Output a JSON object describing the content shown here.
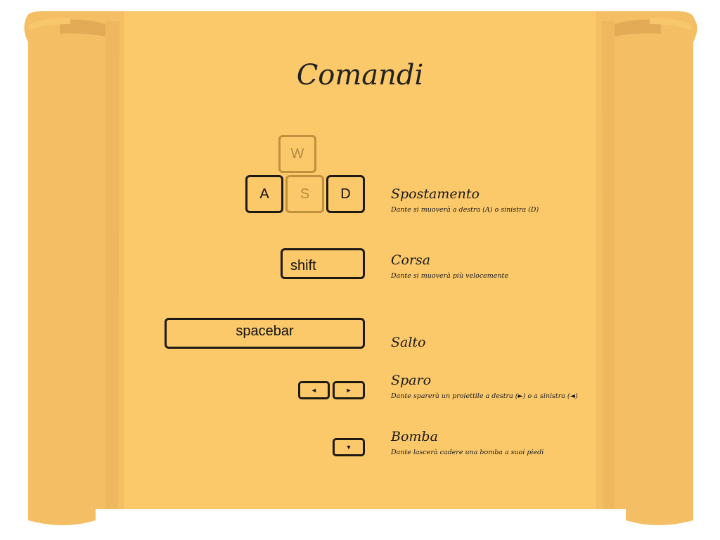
{
  "title": "Comandi",
  "colors": {
    "parchment": "#fbc86a",
    "parchment_shadow": "#f1bd63",
    "roll_inner": "#e7b05b",
    "key_border": "#1e1a12",
    "key_dim": "#c0913c"
  },
  "keys": {
    "w": "W",
    "a": "A",
    "s": "S",
    "d": "D",
    "shift": "shift",
    "spacebar": "spacebar",
    "left_arrow": "◄",
    "right_arrow": "►",
    "down_arrow": "▼"
  },
  "controls": [
    {
      "title": "Spostamento",
      "description": "Dante si muoverà a destra (A) o sinistra (D)"
    },
    {
      "title": "Corsa",
      "description": "Dante si muoverà più velocemente"
    },
    {
      "title": "Salto",
      "description": ""
    },
    {
      "title": "Sparo",
      "description": "Dante sparerà un proiettile a destra (►) o a sinistra (◄)"
    },
    {
      "title": "Bomba",
      "description": "Dante lascerà cadere una bomba a suoi piedi"
    }
  ]
}
